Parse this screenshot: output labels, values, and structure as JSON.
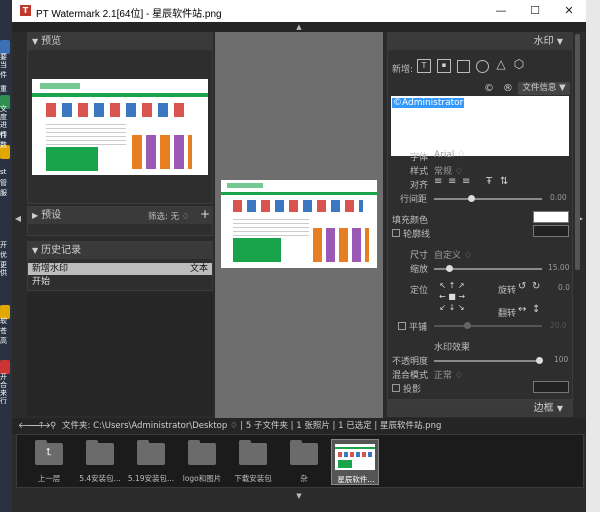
{
  "desktop_left": [
    "要",
    "当",
    "件",
    "重",
    "文",
    "度",
    "进行",
    "件",
    "数",
    "st",
    "管",
    "服",
    "开",
    "优",
    "更",
    "供",
    "软",
    "苍",
    "高",
    "开",
    "合",
    "来",
    "行"
  ],
  "window": {
    "title": "PT Watermark 2.1[64位] - 星辰软件站.png",
    "icon_letter": "T",
    "minimize": "—",
    "maximize": "☐",
    "close": "✕"
  },
  "preview_panel": {
    "title": "预览"
  },
  "presets_panel": {
    "title": "预设",
    "filter_label": "筛选: 无 ♢",
    "add": "+"
  },
  "history_panel": {
    "title": "历史记录",
    "items": [
      {
        "name": "新增水印",
        "type": "文本"
      },
      {
        "name": "开始",
        "type": ""
      }
    ]
  },
  "watermark_panel": {
    "title": "水印",
    "add_label": "新增:",
    "file_info_label": "文件信息",
    "symbols": [
      "©",
      "®",
      "TM"
    ],
    "text_value": "©Administrator",
    "font_label": "字体",
    "font_value": "Arial ♢",
    "style_label": "样式",
    "style_value": "常规 ♢",
    "align_label": "对齐",
    "line_spacing_label": "行间距",
    "line_spacing_value": "0.00",
    "fill_color_label": "填充颜色",
    "outline_label": "轮廓线",
    "size_label": "尺寸",
    "size_value": "自定义 ♢",
    "scale_label": "缩放",
    "scale_value": "15.00",
    "position_label": "定位",
    "rotate_label": "旋转",
    "rotate_value": "0.0",
    "flip_label": "翻转",
    "tile_label": "平铺",
    "tile_value": "20.0",
    "effects_label": "水印效果",
    "opacity_label": "不透明度",
    "opacity_value": "100",
    "blend_label": "混合模式",
    "blend_value": "正常 ♢",
    "shadow_label": "投影",
    "border_panel_title": "边框"
  },
  "file_bar": {
    "path": "文件夹: C:\\Users\\Administrator\\Desktop ♢ | 5 子文件夹 | 1 张照片 | 1 已选定 | 星辰软件站.png"
  },
  "browser_items": [
    {
      "label": "上一层",
      "kind": "up"
    },
    {
      "label": "5.4安装包...",
      "kind": "folder"
    },
    {
      "label": "5.19安装包...",
      "kind": "folder"
    },
    {
      "label": "logo和图片",
      "kind": "folder"
    },
    {
      "label": "下载安装包",
      "kind": "folder"
    },
    {
      "label": "杂",
      "kind": "folder"
    },
    {
      "label": "星辰软件...",
      "kind": "image"
    }
  ],
  "colors": {
    "accent": "#19a34a",
    "selection": "#3399ff",
    "fill": "#ffffff"
  }
}
